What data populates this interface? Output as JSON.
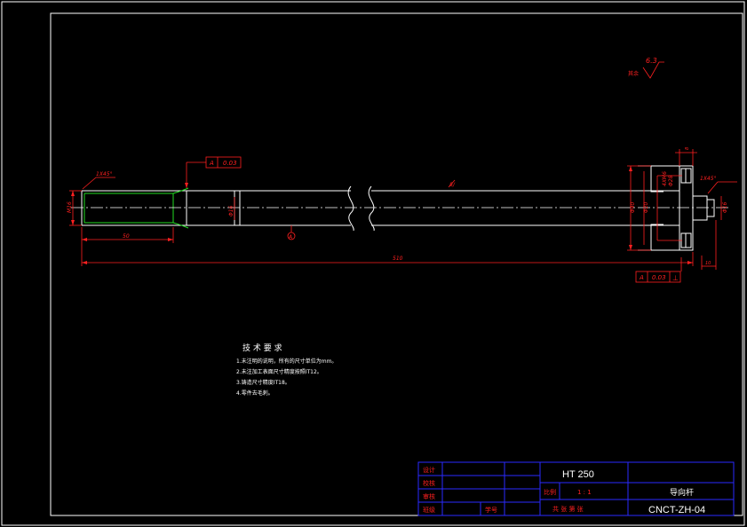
{
  "colors": {
    "background": "#000000",
    "outline": "#ffffff",
    "dimension": "#ff2020",
    "thread": "#22dd22",
    "centerline": "#ffffff",
    "title_block": "#2a2aff"
  },
  "dimensions": {
    "left_chamfer": "1X45°",
    "thread_dia": "M16",
    "thread_len": "50",
    "geo_tol_value": "0.03",
    "datum_letter": "A",
    "shaft_dia": "Φ16",
    "overall_len": "510",
    "surface_mark": "8/",
    "datum_marker": "A",
    "right_chamfer": "1X45°",
    "flange_dia1": "Φ40",
    "flange_dia2": "Φ20",
    "bolt_dim1": "4XM6",
    "bolt_dim2": "Φ28",
    "flange_thk": "8",
    "right_dia": "Φ16",
    "right_small": "10",
    "bottom_tol_datum": "A",
    "bottom_tol_value": "0.03",
    "bottom_tol_symbol": "⊥",
    "roughness_value": "6.3",
    "roughness_label": "其余"
  },
  "notes": {
    "heading": "技  术  要  求",
    "items": [
      "1.未注明的说明，所有的尺寸单位为mm。",
      "2.未注加工表面尺寸精度按照IT12。",
      "3.铸造尺寸精度IT18。",
      "4.零件去毛刺。"
    ]
  },
  "title_block": {
    "row_labels": [
      "设计",
      "校核",
      "审核",
      "班级"
    ],
    "student_label": "学号",
    "material": "HT 250",
    "scale_label": "比例",
    "scale_value": "1 : 1",
    "sheet_info": "共    张    第    张",
    "part_name": "导向杆",
    "drawing_no": "CNCT-ZH-04"
  }
}
